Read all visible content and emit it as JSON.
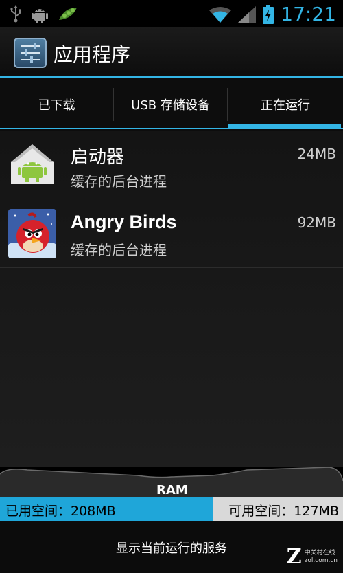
{
  "status_bar": {
    "time": "17:21",
    "icons": [
      "usb-icon",
      "android-debug-icon",
      "pea-app-icon",
      "wifi-icon",
      "signal-icon",
      "battery-charging-icon"
    ]
  },
  "title_bar": {
    "title": "应用程序",
    "icon": "settings-app-icon"
  },
  "tabs": {
    "items": [
      {
        "label": "已下载"
      },
      {
        "label": "USB 存储设备"
      },
      {
        "label": "正在运行"
      }
    ],
    "selected": "正在运行"
  },
  "apps": [
    {
      "name": "启动器",
      "status": "缓存的后台进程",
      "size": "24MB",
      "icon": "launcher-icon"
    },
    {
      "name": "Angry Birds",
      "status": "缓存的后台进程",
      "size": "92MB",
      "icon": "angry-birds-icon"
    }
  ],
  "ram": {
    "label": "RAM",
    "used_text": "已用空间：208MB",
    "free_text": "可用空间：127MB",
    "used_fraction": 0.621
  },
  "footer": {
    "button_label": "显示当前运行的服务"
  },
  "watermark": {
    "line1": "中关村在线",
    "line2": "zol.com.cn"
  },
  "colors": {
    "accent": "#33b5e5",
    "ram_used": "#1fa6d9"
  }
}
